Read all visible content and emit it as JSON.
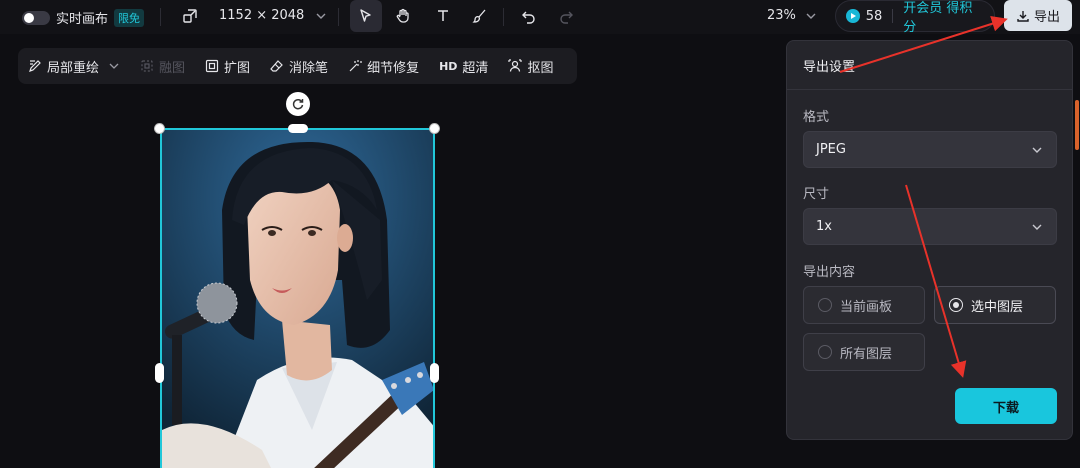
{
  "topbar": {
    "realtime_canvas_label": "实时画布",
    "limited_badge": "限免",
    "canvas_size": "1152 × 2048",
    "zoom": "23%",
    "points": "58",
    "vip_label": "开会员 得积分",
    "export_label": "导出"
  },
  "subbar": {
    "items": [
      "局部重绘",
      "融图",
      "扩图",
      "消除笔",
      "细节修复",
      "超清",
      "抠图"
    ],
    "hd_tag": "HD"
  },
  "panel": {
    "title": "导出设置",
    "format_label": "格式",
    "format_value": "JPEG",
    "size_label": "尺寸",
    "size_value": "1x",
    "content_label": "导出内容",
    "options": [
      "当前画板",
      "选中图层",
      "所有图层"
    ],
    "selected_option": "选中图层",
    "download_label": "下载"
  },
  "colors": {
    "accent": "#19c6dd",
    "annotation_arrow": "#e8322a"
  }
}
